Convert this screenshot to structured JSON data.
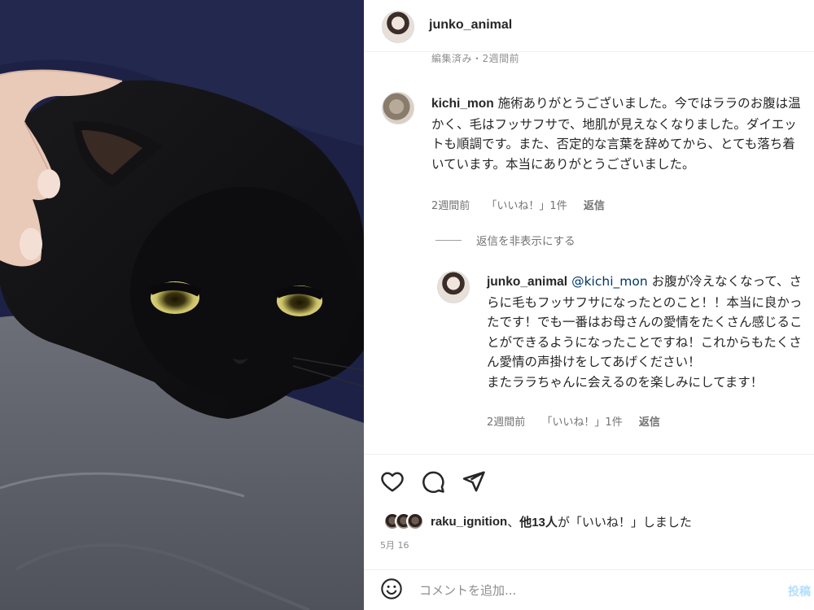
{
  "post": {
    "username": "junko_animal",
    "cut_off_text": "編集済み・2週間前"
  },
  "comment": {
    "username": "kichi_mon",
    "text": "施術ありがとうございました。今ではララのお腹は温かく、毛はフッサフサで、地肌が見えなくなりました。ダイエットも順調です。また、否定的な言葉を辞めてから、とても落ち着いています。本当にありがとうございました。",
    "time": "2週間前",
    "likes": "「いいね！」1件",
    "reply_label": "返信"
  },
  "hide_replies_label": "返信を非表示にする",
  "reply": {
    "username": "junko_animal",
    "mention": "@kichi_mon",
    "text": " お腹が冷えなくなって、さらに毛もフッサフサになったとのこと！！本当に良かったです！でも一番はお母さんの愛情をたくさん感じることができるようになったことですね！これからもたくさん愛情の声掛けをしてあげください！",
    "text2": "またララちゃんに会えるのを楽しみにしてます！",
    "time": "2週間前",
    "likes": "「いいね！」1件",
    "reply_label": "返信"
  },
  "actions": {
    "like_icon": "heart-icon",
    "comment_icon": "speech-bubble-icon",
    "share_icon": "paper-plane-icon"
  },
  "likes_summary": {
    "user": "raku_ignition",
    "sep": "、",
    "others": "他13人",
    "suffix": "が「いいね！」しました"
  },
  "date": "5月 16",
  "comment_box": {
    "placeholder": "コメントを追加...",
    "post_label": "投稿"
  },
  "colors": {
    "link": "#00376b",
    "muted": "#737373",
    "post_button": "#b2dffc"
  }
}
